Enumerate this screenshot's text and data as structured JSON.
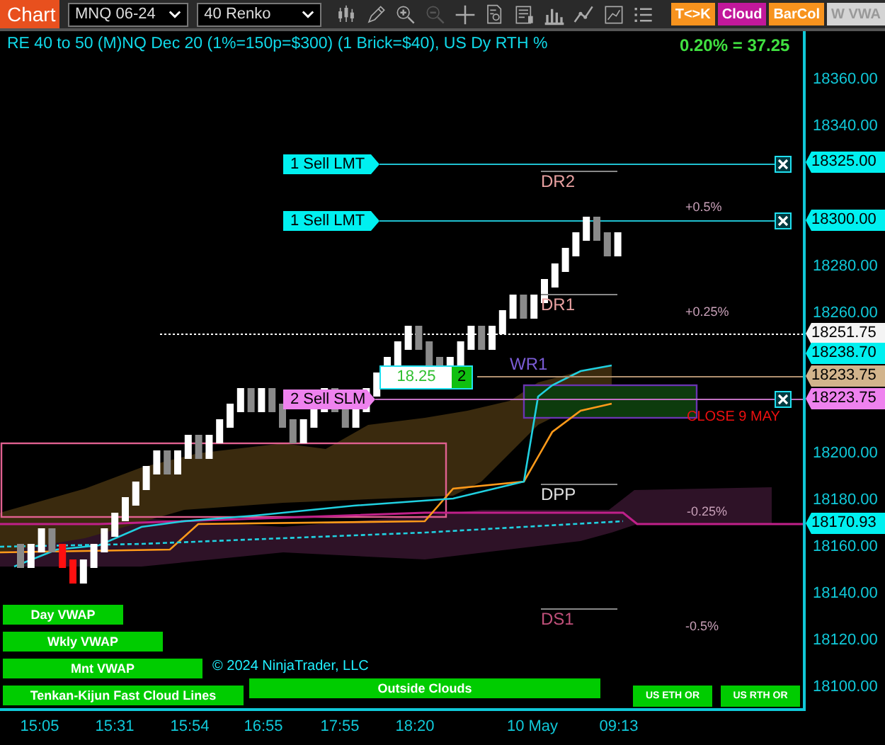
{
  "toolbar": {
    "title": "Chart",
    "instrument": "MNQ 06-24",
    "bar_type": "40 Renko",
    "buttons": [
      {
        "label": "T<>K",
        "color": "#f7931e"
      },
      {
        "label": "Cloud",
        "color": "#c2189b"
      },
      {
        "label": "BarCol",
        "color": "#f7931e"
      },
      {
        "label": "W VWA",
        "color": "#d4d4d4"
      }
    ]
  },
  "chart": {
    "header": "RE 40 to 50 (M)NQ Dec 20 (1%=150p=$300) (1 Brick=$40), US Dy RTH %",
    "change": "0.20% = 37.25",
    "orders": [
      {
        "label": "1 Sell LMT",
        "kind": "limit"
      },
      {
        "label": "1 Sell LMT",
        "kind": "limit"
      },
      {
        "label": "2 Sell SLM",
        "kind": "stop"
      }
    ],
    "position": {
      "price": "18.25",
      "quantity": "2"
    },
    "levels": [
      {
        "label": "DR2",
        "color": "#e8a0a0"
      },
      {
        "label": "DR1",
        "color": "#e8a0a0"
      },
      {
        "label": "WR1",
        "color": "#7b5cd6"
      },
      {
        "label": "DPP",
        "color": "#e0e0e0"
      },
      {
        "label": "DS1",
        "color": "#c0507a"
      }
    ],
    "percent_labels": [
      "+0.5%",
      "+0.25%",
      "-0.25%",
      "-0.5%"
    ],
    "session_label": "CLOSE 9 MAY",
    "indicator_buttons": [
      "Day VWAP",
      "Wkly VWAP",
      "Mnt VWAP",
      "Tenkan-Kijun Fast Cloud Lines",
      "Outside Clouds",
      "US ETH OR",
      "US RTH OR"
    ],
    "copyright": "© 2024 NinjaTrader, LLC",
    "price_axis": {
      "ticks": [
        "18360.00",
        "18340.00",
        "18280.00",
        "18260.00",
        "18200.00",
        "18180.00",
        "18160.00",
        "18140.00",
        "18120.00",
        "18100.00"
      ]
    },
    "price_markers": [
      {
        "label": "18325.00",
        "color": "#00f0f0"
      },
      {
        "label": "18300.00",
        "color": "#00f0f0"
      },
      {
        "label": "18251.75",
        "color": "#f4f4f4"
      },
      {
        "label": "18238.70",
        "color": "#00f0f0"
      },
      {
        "label": "18233.75",
        "color": "#d2b48c"
      },
      {
        "label": "18223.75",
        "color": "#ee82ee"
      },
      {
        "label": "18170.93",
        "color": "#00f0f0"
      }
    ],
    "time_axis": [
      "15:05",
      "15:31",
      "15:54",
      "16:55",
      "17:55",
      "18:20",
      "10 May",
      "09:13"
    ]
  }
}
